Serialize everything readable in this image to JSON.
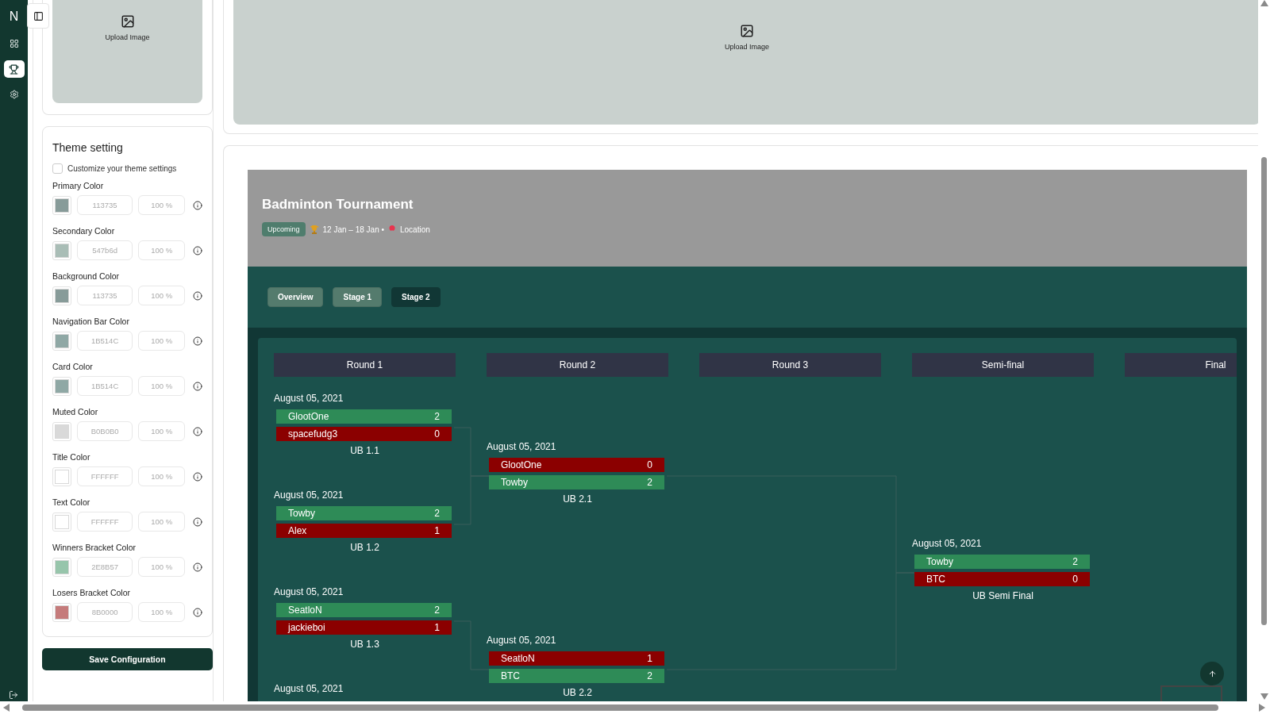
{
  "nav": {
    "logo": "N",
    "items": [
      {
        "kind": "dashboard",
        "selected": false
      },
      {
        "kind": "trophy",
        "selected": true
      },
      {
        "kind": "settings",
        "selected": false
      }
    ]
  },
  "upload_cards": [
    {
      "label": "Upload Image"
    },
    {
      "label": "Upload Image"
    }
  ],
  "theme": {
    "title": "Theme setting",
    "customize": {
      "label": "Customize your theme settings",
      "checked": false
    },
    "colors": [
      {
        "label": "Primary Color",
        "color": "#879b99",
        "hex": "113735",
        "opacity": "100 %"
      },
      {
        "label": "Secondary Color",
        "color": "#a9bdb6",
        "hex": "547b6d",
        "opacity": "100 %"
      },
      {
        "label": "Background Color",
        "color": "#879b99",
        "hex": "113735",
        "opacity": "100 %"
      },
      {
        "label": "Navigation Bar Color",
        "color": "#8fa8a5",
        "hex": "1B514C",
        "opacity": "100 %"
      },
      {
        "label": "Card Color",
        "color": "#8fa8a5",
        "hex": "1B514C",
        "opacity": "100 %"
      },
      {
        "label": "Muted Color",
        "color": "#d9d9d9",
        "hex": "B0B0B0",
        "opacity": "100 %"
      },
      {
        "label": "Title Color",
        "color": "#ffffff",
        "hex": "FFFFFF",
        "opacity": "100 %"
      },
      {
        "label": "Text Color",
        "color": "#ffffff",
        "hex": "FFFFFF",
        "opacity": "100 %"
      },
      {
        "label": "Winners Bracket Color",
        "color": "#97c5ab",
        "hex": "2E8B57",
        "opacity": "100 %"
      },
      {
        "label": "Losers Bracket Color",
        "color": "#c57b7b",
        "hex": "8B0000",
        "opacity": "100 %"
      }
    ],
    "save_button": "Save Configuration"
  },
  "tournament": {
    "title": "Badminton Tournament",
    "status": "Upcoming",
    "dates": "12 Jan – 18 Jan •",
    "location": "Location",
    "tabs": [
      {
        "label": "Overview",
        "selected": false
      },
      {
        "label": "Stage 1",
        "selected": false
      },
      {
        "label": "Stage 2",
        "selected": true
      }
    ],
    "rounds": [
      {
        "title": "Round 1",
        "matches": [
          {
            "date": "August 05, 2021",
            "label": "UB 1.1",
            "teams": [
              {
                "name": "GlootOne",
                "score": "2",
                "won": true
              },
              {
                "name": "spacefudg3",
                "score": "0",
                "won": false
              }
            ]
          },
          {
            "date": "August 05, 2021",
            "label": "UB 1.2",
            "teams": [
              {
                "name": "Towby",
                "score": "2",
                "won": true
              },
              {
                "name": "Alex",
                "score": "1",
                "won": false
              }
            ]
          },
          {
            "date": "August 05, 2021",
            "label": "UB 1.3",
            "teams": [
              {
                "name": "SeatloN",
                "score": "2",
                "won": true
              },
              {
                "name": "jackieboi",
                "score": "1",
                "won": false
              }
            ]
          },
          {
            "date": "August 05, 2021"
          }
        ]
      },
      {
        "title": "Round 2",
        "matches": [
          {
            "date": "August 05, 2021",
            "label": "UB 2.1",
            "teams": [
              {
                "name": "GlootOne",
                "score": "0",
                "won": false
              },
              {
                "name": "Towby",
                "score": "2",
                "won": true
              }
            ]
          },
          {
            "date": "August 05, 2021",
            "label": "UB 2.2",
            "teams": [
              {
                "name": "SeatloN",
                "score": "1",
                "won": false
              },
              {
                "name": "BTC",
                "score": "2",
                "won": true
              }
            ]
          }
        ]
      },
      {
        "title": "Round 3"
      },
      {
        "title": "Semi-final",
        "matches": [
          {
            "date": "August 05, 2021",
            "label": "UB Semi Final",
            "teams": [
              {
                "name": "Towby",
                "score": "2",
                "won": true
              },
              {
                "name": "BTC",
                "score": "0",
                "won": false
              }
            ]
          }
        ]
      },
      {
        "title": "Final"
      }
    ]
  }
}
